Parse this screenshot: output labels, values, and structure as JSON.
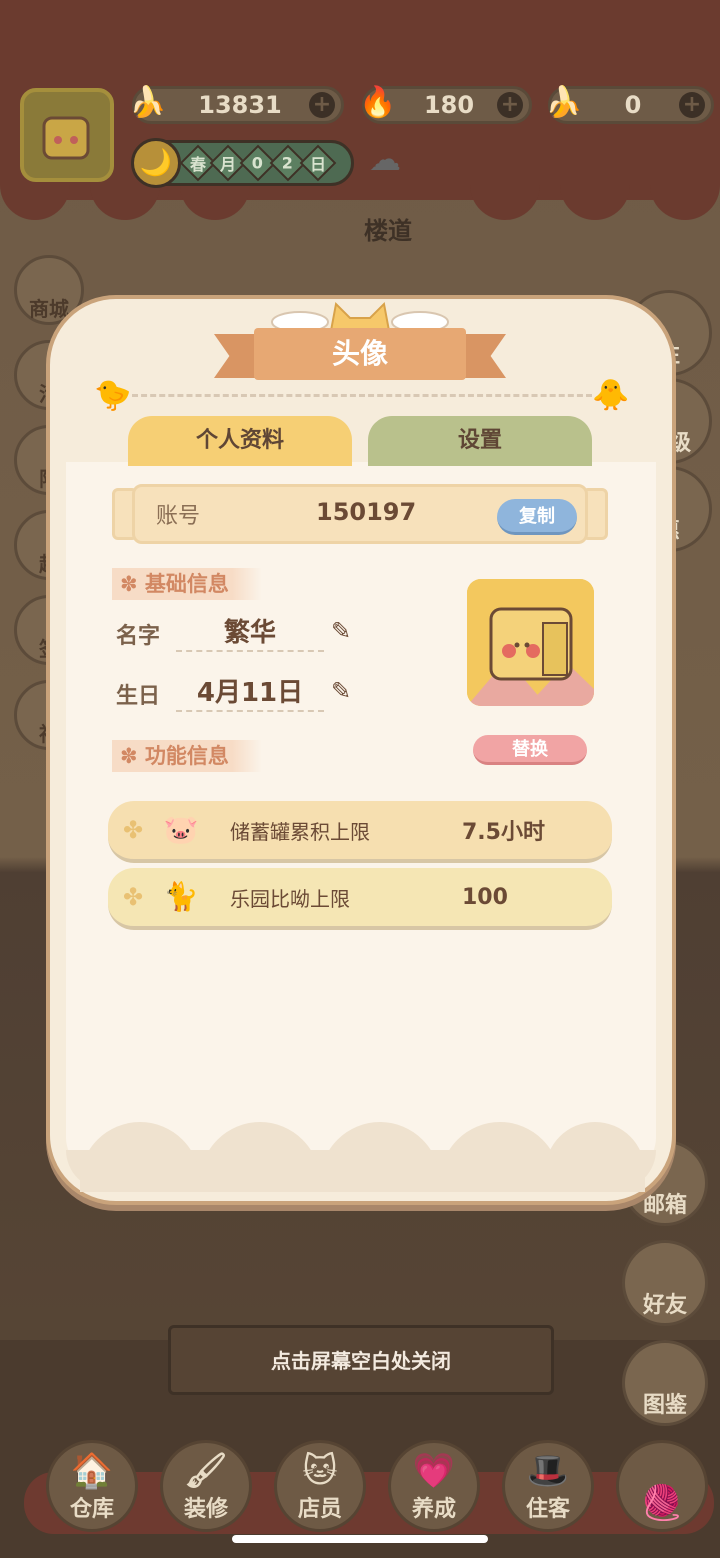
{
  "topbar": {
    "resources": [
      {
        "icon": "banana-icon",
        "value": "13831"
      },
      {
        "icon": "blue-flame-icon",
        "value": "180"
      },
      {
        "icon": "blue-banana-icon",
        "value": "0"
      }
    ],
    "date": {
      "season": "春",
      "month": "月",
      "d1": "0",
      "d2": "2",
      "day": "日"
    },
    "weather_icon": "rain-cloud-icon",
    "floor_sign": "楼道"
  },
  "side_left": [
    "商城",
    "活",
    "限",
    "超",
    "签",
    "神"
  ],
  "side_right": [
    "往",
    "等级",
    "惠",
    "邮箱",
    "好友",
    "图鉴"
  ],
  "dock": [
    "仓库",
    "装修",
    "店员",
    "养成",
    "住客"
  ],
  "close_hint": "点击屏幕空白处关闭",
  "modal": {
    "title": "头像",
    "tabs": {
      "profile": "个人资料",
      "settings": "设置"
    },
    "account": {
      "label": "账号",
      "value": "150197",
      "copy": "复制"
    },
    "basic_section": "基础信息",
    "name": {
      "label": "名字",
      "value": "繁华"
    },
    "birthday": {
      "label": "生日",
      "value": "4月11日"
    },
    "func_section": "功能信息",
    "swap": "替换",
    "functions": [
      {
        "label": "储蓄罐累积上限",
        "value": "7.5小时"
      },
      {
        "label": "乐园比呦上限",
        "value": "100"
      }
    ]
  },
  "colors": {
    "tab_profile": "#f6cf74",
    "tab_settings": "#b9c18c",
    "copy_button": "#8fb5dc",
    "swap_button": "#f1a4a4"
  }
}
